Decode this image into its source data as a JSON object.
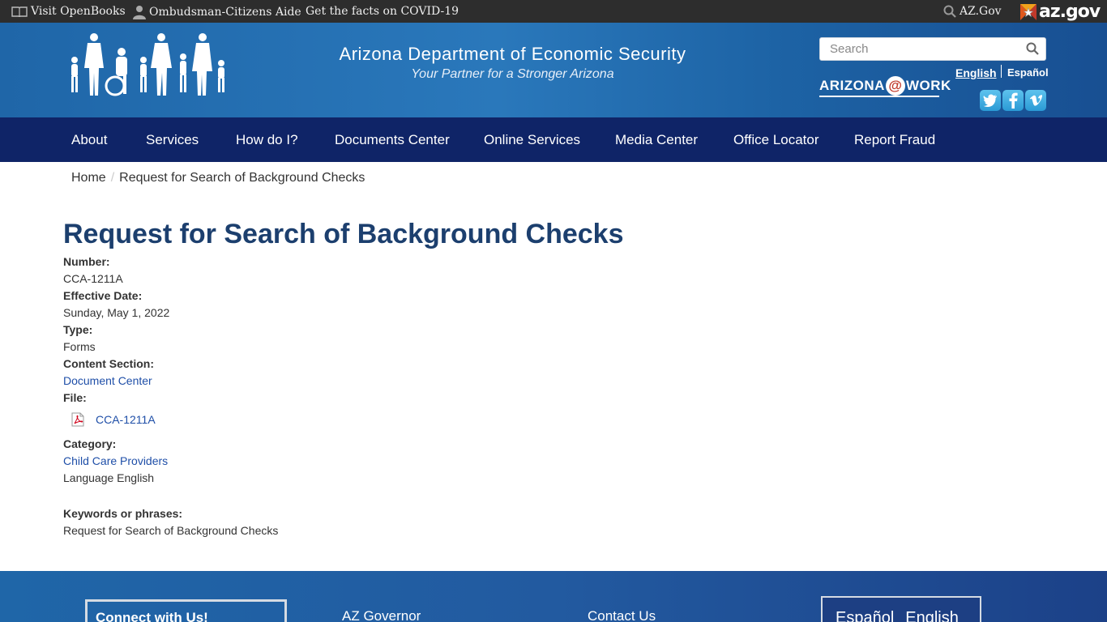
{
  "topbar": {
    "openbooks": "Visit OpenBooks",
    "ombudsman": "Ombudsman-Citizens Aide",
    "covid": "Get the facts on COVID-19",
    "azgov_search": "AZ.Gov",
    "azgov_logo": "az.gov"
  },
  "header": {
    "title": "Arizona Department of Economic Security",
    "tagline": "Your Partner for a Stronger Arizona",
    "search_placeholder": "Search",
    "azwork_left": "ARIZONA",
    "azwork_at": "@",
    "azwork_right": "WORK",
    "lang_english": "English",
    "lang_espanol": "Español"
  },
  "nav": {
    "items": [
      "About",
      "Services",
      "How do I?",
      "Documents Center",
      "Online Services",
      "Media Center",
      "Office Locator",
      "Report Fraud"
    ]
  },
  "breadcrumb": {
    "home": "Home",
    "current": "Request for Search of Background Checks"
  },
  "main": {
    "title": "Request for Search of Background Checks",
    "number_label": "Number:",
    "number_value": "CCA-1211A",
    "date_label": "Effective Date:",
    "date_value": "Sunday, May 1, 2022",
    "type_label": "Type:",
    "type_value": "Forms",
    "section_label": "Content Section:",
    "section_value": "Document Center",
    "file_label": "File:",
    "file_name": "CCA-1211A",
    "category_label": "Category:",
    "category_value": "Child Care Providers",
    "language_line": "Language English",
    "keywords_label": "Keywords or phrases:",
    "keywords_value": "Request for Search of Background Checks"
  },
  "footer": {
    "connect": "Connect with Us!",
    "governor": "AZ Governor",
    "contact": "Contact Us",
    "espanol": "Español",
    "english": "English"
  },
  "colors": {
    "nav_bg": "#0f2467",
    "header_blue": "#2a78bb",
    "title_blue": "#1c3f6e",
    "link_blue": "#1f4fa8"
  }
}
